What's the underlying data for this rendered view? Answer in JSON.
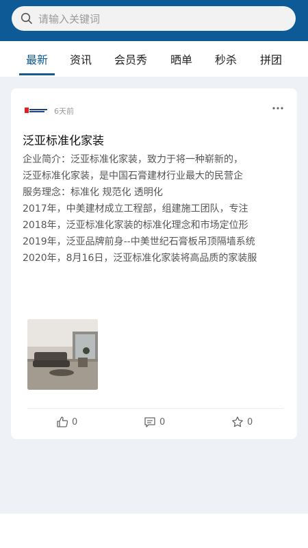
{
  "search": {
    "placeholder": "请输入关键词",
    "icon": "search-icon"
  },
  "tabs": [
    {
      "label": "最新",
      "active": true
    },
    {
      "label": "资讯"
    },
    {
      "label": "会员秀"
    },
    {
      "label": "晒单"
    },
    {
      "label": "秒杀"
    },
    {
      "label": "拼团"
    }
  ],
  "post": {
    "time": "6天前",
    "title": "泛亚标准化家装",
    "lines": [
      "企业简介：泛亚标准化家装，致力于将一种崭新的，",
      "泛亚标准化家装，是中国石膏建材行业最大的民营企",
      "服务理念：标准化  规范化  透明化",
      "2017年，中美建材成立工程部，组建施工团队，专注",
      "2018年，泛亚标准化家装的标准化理念和市场定位形",
      "2019年，泛亚品牌前身--中美世纪石膏板吊顶隔墙系统",
      "2020年，8月16日，泛亚标准化家装将高品质的家装服"
    ],
    "likes": "0",
    "comments": "0",
    "favorites": "0"
  },
  "colors": {
    "brand": "#0d5a96",
    "background": "#eef1f5"
  }
}
